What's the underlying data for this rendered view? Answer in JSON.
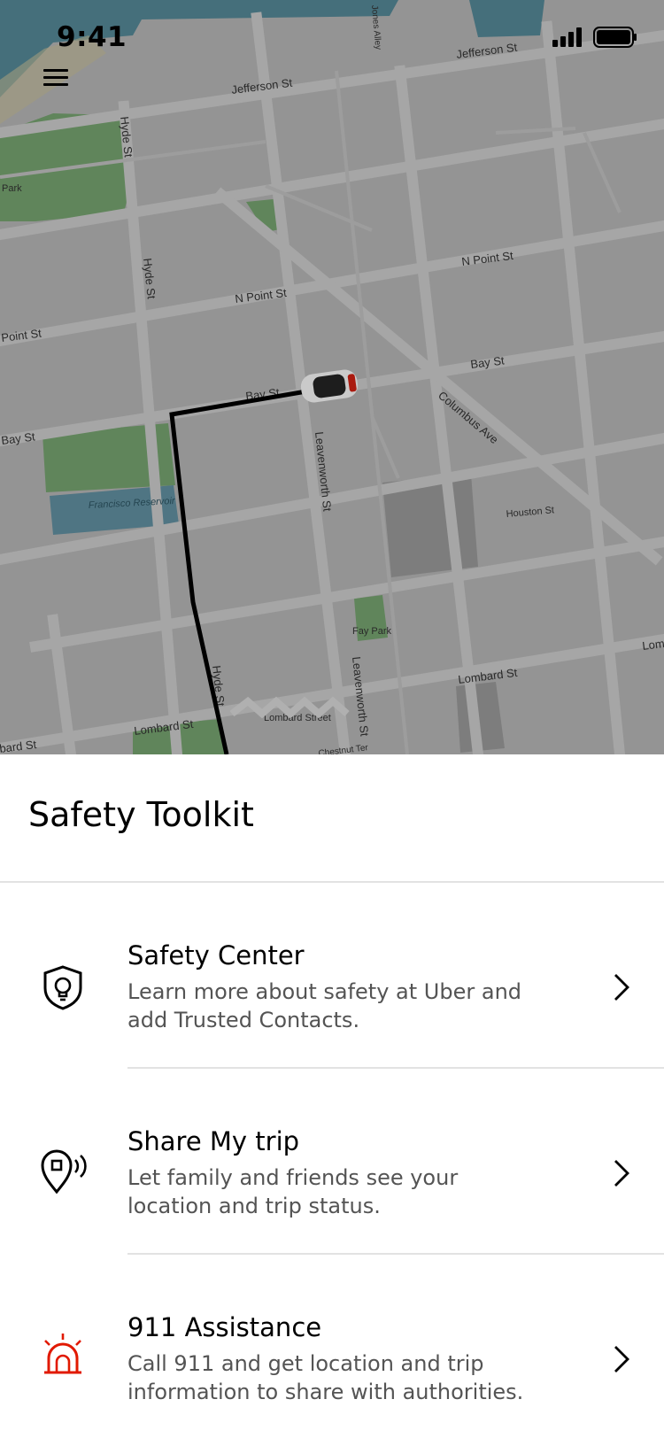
{
  "status_bar": {
    "time": "9:41"
  },
  "map": {
    "street_labels": [
      "Jefferson St",
      "Jefferson St",
      "Jones Alley",
      "Hyde St",
      "Hyde St",
      "N Point St",
      "N Point St",
      "Point St",
      "Bay St",
      "Bay St",
      "Bay St",
      "Columbus Ave",
      "Leavenworth St",
      "Leavenworth St",
      "Houston St",
      "Lombard St",
      "Lombard St",
      "Lombard Street",
      "Lom",
      "bard St",
      "Hyde St",
      "Chestnut Ter"
    ],
    "place_labels": [
      "Park",
      "Francisco Reservoir",
      "Fay Park"
    ]
  },
  "sheet": {
    "title": "Safety Toolkit",
    "items": [
      {
        "title": "Safety Center",
        "description": "Learn more about safety at Uber and add Trusted Contacts.",
        "icon": "shield-lightbulb-icon"
      },
      {
        "title": "Share My trip",
        "description": "Let family and friends see your location and trip status.",
        "icon": "location-share-icon"
      },
      {
        "title": "911 Assistance",
        "description": "Call 911 and get location and trip information to share with authorities.",
        "icon": "emergency-siren-icon",
        "icon_color": "#E11900"
      }
    ]
  },
  "colors": {
    "accent_red": "#E11900",
    "map_overlay": "#a6a6a6",
    "route": "#000000"
  }
}
